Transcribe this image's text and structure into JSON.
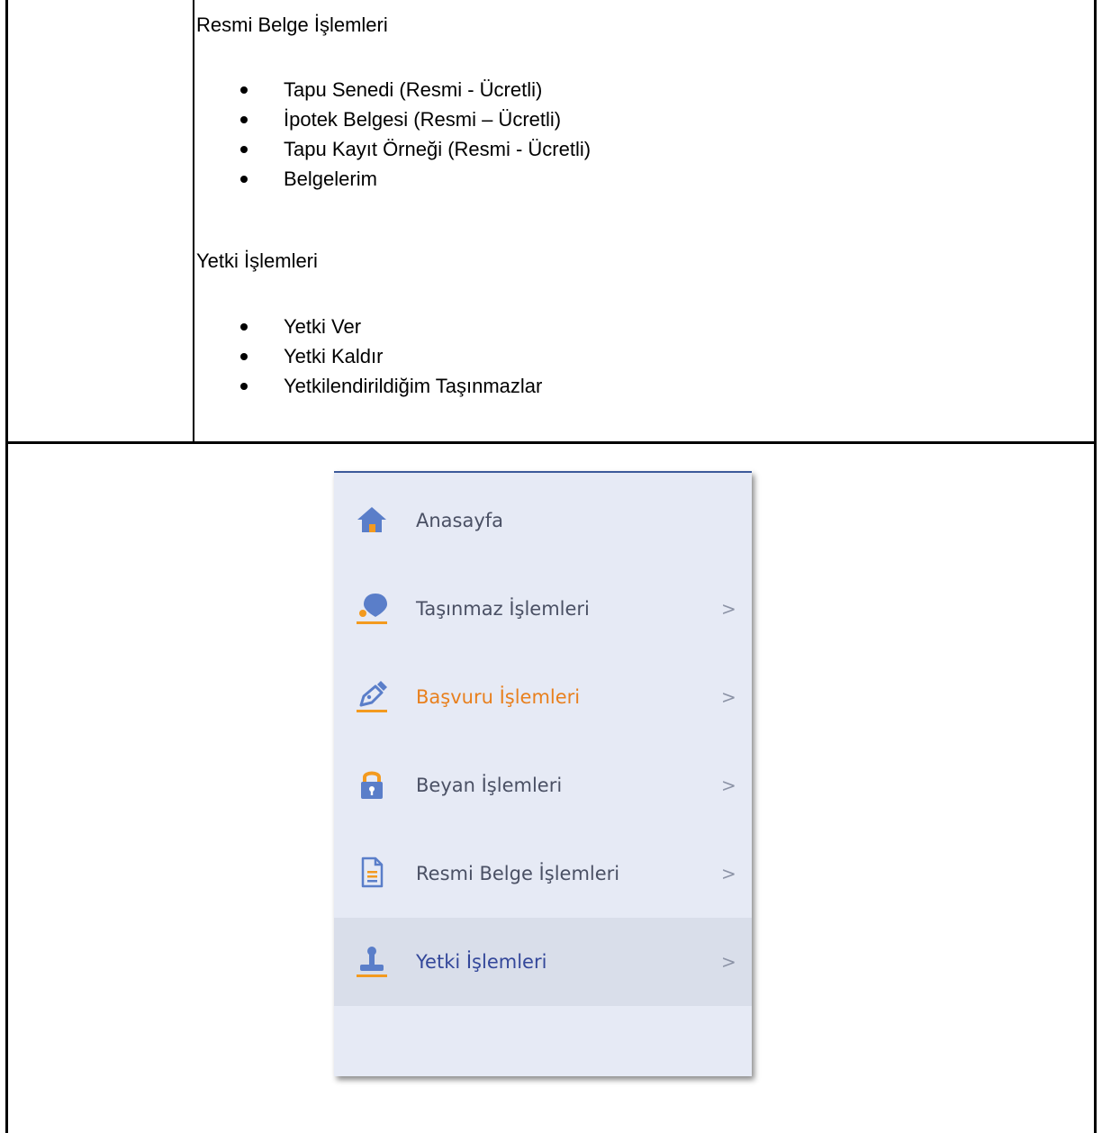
{
  "document": {
    "sections": [
      {
        "heading": "Resmi Belge İşlemleri",
        "items": [
          "Tapu Senedi (Resmi - Ücretli)",
          "İpotek Belgesi (Resmi – Ücretli)",
          "Tapu Kayıt Örneği (Resmi - Ücretli)",
          "Belgelerim"
        ]
      },
      {
        "heading": "Yetki İşlemleri",
        "items": [
          "Yetki Ver",
          "Yetki Kaldır",
          "Yetkilendirildiğim Taşınmazlar"
        ]
      }
    ]
  },
  "menu": {
    "colors": {
      "panel_bg": "#e6eaf5",
      "active_bg": "#d9deea",
      "icon_blue": "#5a7ec9",
      "accent_orange": "#f39a1f",
      "label_gray": "#4a5064",
      "label_orange": "#e8801e",
      "label_blue": "#33479a"
    },
    "chevron": ">",
    "items": [
      {
        "label": "Anasayfa",
        "icon": "home-icon",
        "has_chevron": false
      },
      {
        "label": "Taşınmaz İşlemleri",
        "icon": "map-pin-icon",
        "has_chevron": true
      },
      {
        "label": "Başvuru İşlemleri",
        "icon": "pen-icon",
        "has_chevron": true,
        "highlighted": true
      },
      {
        "label": "Beyan İşlemleri",
        "icon": "lock-icon",
        "has_chevron": true
      },
      {
        "label": "Resmi Belge İşlemleri",
        "icon": "document-icon",
        "has_chevron": true
      },
      {
        "label": "Yetki İşlemleri",
        "icon": "stamp-icon",
        "has_chevron": true,
        "selected": true
      }
    ]
  }
}
